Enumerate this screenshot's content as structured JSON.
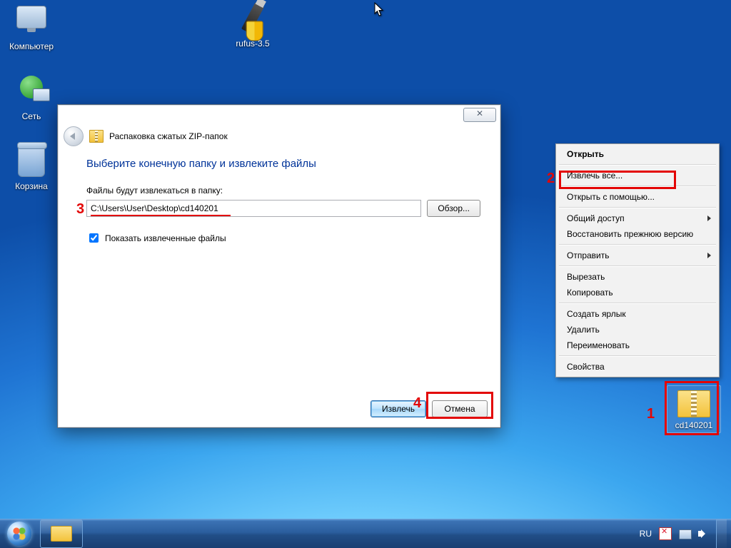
{
  "desktop": {
    "icons": {
      "computer": "Компьютер",
      "network": "Сеть",
      "recycle_bin": "Корзина",
      "rufus": "rufus-3.5",
      "zip_file": "cd140201"
    }
  },
  "wizard": {
    "header": "Распаковка сжатых ZIP-папок",
    "title": "Выберите конечную папку и извлеките файлы",
    "dest_label": "Файлы будут извлекаться в папку:",
    "dest_value": "C:\\Users\\User\\Desktop\\cd140201",
    "browse": "Обзор...",
    "show_files": "Показать извлеченные файлы",
    "extract": "Извлечь",
    "cancel": "Отмена",
    "close_glyph": "✕"
  },
  "context_menu": {
    "open": "Открыть",
    "extract_all": "Извлечь все...",
    "open_with": "Открыть с помощью...",
    "share": "Общий доступ",
    "restore_prev": "Восстановить прежнюю версию",
    "send_to": "Отправить",
    "cut": "Вырезать",
    "copy": "Копировать",
    "create_shortcut": "Создать ярлык",
    "delete": "Удалить",
    "rename": "Переименовать",
    "properties": "Свойства"
  },
  "taskbar": {
    "language": "RU"
  },
  "annotations": {
    "n1": "1",
    "n2": "2",
    "n3": "3",
    "n4": "4"
  }
}
